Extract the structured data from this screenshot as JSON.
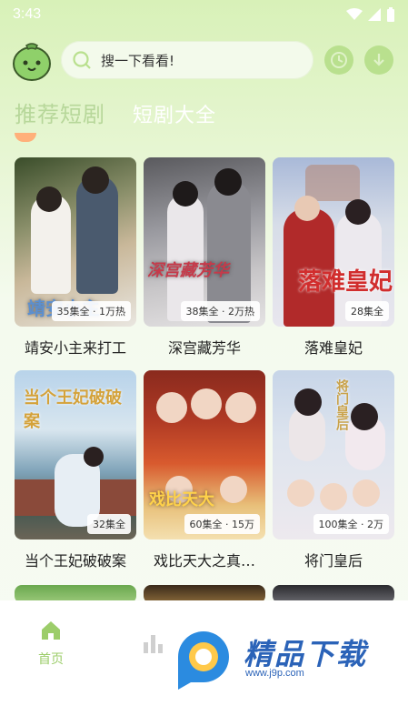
{
  "status_bar": {
    "time": "3:43"
  },
  "header": {
    "search_placeholder": "搜一下看看!",
    "icons": [
      "history-icon",
      "download-icon"
    ]
  },
  "tabs": [
    {
      "label": "推荐短剧",
      "active": true
    },
    {
      "label": "短剧大全",
      "active": false
    }
  ],
  "dramas": [
    {
      "title": "靖安小主来打工",
      "badge": "35集全 · 1万热",
      "poster_text": "靖安小主"
    },
    {
      "title": "深宫藏芳华",
      "badge": "38集全 · 2万热",
      "poster_text": "深宫藏芳华"
    },
    {
      "title": "落难皇妃",
      "badge": "28集全",
      "poster_text": "落难皇妃"
    },
    {
      "title": "当个王妃破破案",
      "badge": "32集全",
      "poster_text": "当个王妃破破案"
    },
    {
      "title": "戏比天大之真…",
      "badge": "60集全 · 15万",
      "poster_text": "戏比天大"
    },
    {
      "title": "将门皇后",
      "badge": "100集全 · 2万",
      "poster_text": "将门皇后"
    }
  ],
  "bottom_nav": [
    {
      "label": "首页",
      "icon": "home-icon",
      "active": true
    },
    {
      "label": "",
      "icon": "chart-icon",
      "active": false
    }
  ],
  "watermark": {
    "text": "精品下载",
    "url": "www.j9p.com"
  },
  "colors": {
    "accent": "#9ccd6a",
    "tab_indicator": "#ffb07a"
  }
}
